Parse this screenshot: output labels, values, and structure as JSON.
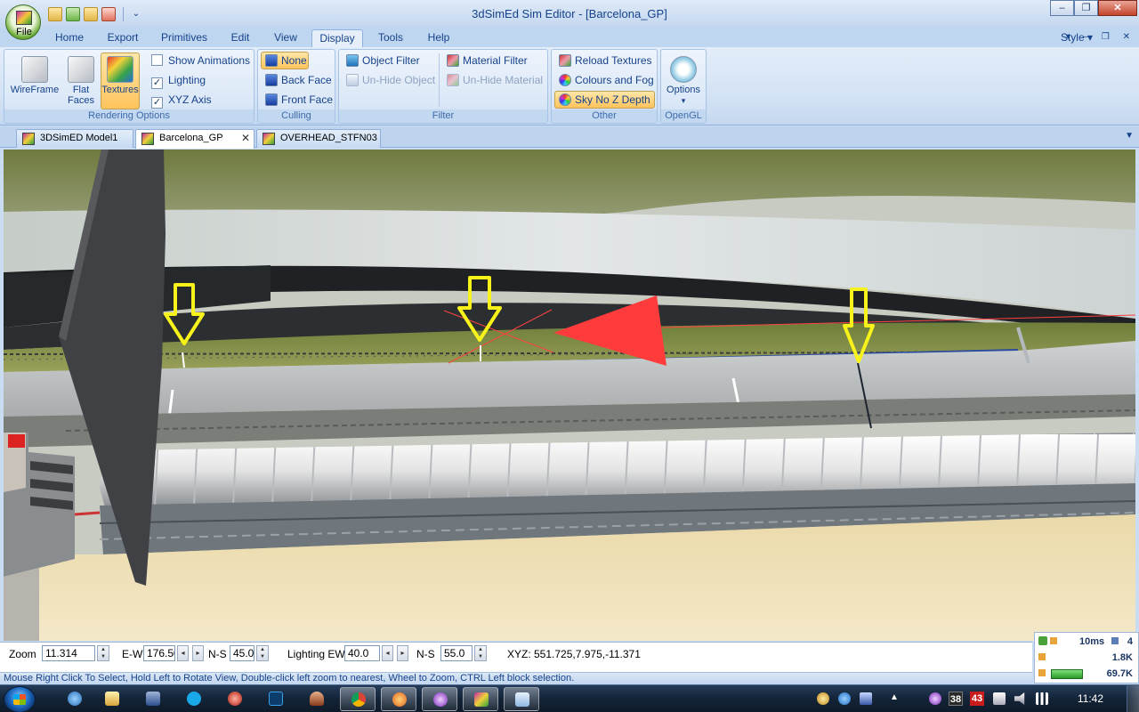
{
  "window": {
    "title": "3dSimEd Sim Editor - [Barcelona_GP]",
    "file_button": "File",
    "minimize": "–",
    "maximize": "❐",
    "close": "✕"
  },
  "ribbon_tabs": [
    "Home",
    "Export",
    "Primitives",
    "Edit",
    "View",
    "Display",
    "Tools",
    "Help"
  ],
  "active_tab": "Display",
  "style_menu": "Style",
  "tab_controls": "▾ – ❐ ✕",
  "rendering_options": {
    "label": "Rendering Options",
    "wireframe": "WireFrame",
    "flat_faces_line1": "Flat",
    "flat_faces_line2": "Faces",
    "textures": "Textures",
    "show_animations": "Show Animations",
    "lighting": "Lighting",
    "xyz_axis": "XYZ Axis",
    "show_animations_checked": false,
    "lighting_checked": true,
    "xyz_axis_checked": true
  },
  "culling": {
    "label": "Culling",
    "none": "None",
    "back_face": "Back Face",
    "front_face": "Front Face"
  },
  "filter": {
    "label": "Filter",
    "object_filter": "Object Filter",
    "unhide_object": "Un-Hide Object",
    "material_filter": "Material Filter",
    "unhide_material": "Un-Hide Material"
  },
  "other": {
    "label": "Other",
    "reload_textures": "Reload Textures",
    "colours_fog": "Colours and Fog",
    "sky_no_z": "Sky No Z Depth"
  },
  "opengl": {
    "label": "OpenGL",
    "options": "Options",
    "caret": "▾"
  },
  "doc_tabs": [
    {
      "label": "3DSimED Model1",
      "active": false
    },
    {
      "label": "Barcelona_GP",
      "active": true
    },
    {
      "label": "OVERHEAD_STFN03",
      "active": false
    }
  ],
  "doc_tab_close": "✕",
  "doc_tab_menu": "▼",
  "coords": {
    "zoom_label": "Zoom",
    "zoom_value": "11.314",
    "ew_label": "E-W",
    "ew_value": "176.50",
    "ns_label": "N-S",
    "ns_value": "45.0",
    "lighting_ew_label": "Lighting EW",
    "lighting_ew_value": "40.0",
    "lighting_ns_label": "N-S",
    "lighting_ns_value": "55.0",
    "xyz_readout": "XYZ: 551.725,7.975,-11.371"
  },
  "stats": {
    "ms": "10ms",
    "count": "4",
    "val1": "1.8K",
    "val2": "69.7K"
  },
  "status_text": "Mouse Right Click To Select, Hold Left to Rotate View, Double-click left  zoom to nearest, Wheel to Zoom, CTRL Left block selection.",
  "taskbar": {
    "badge1": "38",
    "badge2": "43",
    "clock": "11:42"
  },
  "colors": {
    "ribbon_bg": "#d1e1f4",
    "active_highlight": "#ffc35c",
    "accent_text": "#15428b",
    "marker_yellow": "#ffff00",
    "pointer_red": "#ff3b3b"
  }
}
